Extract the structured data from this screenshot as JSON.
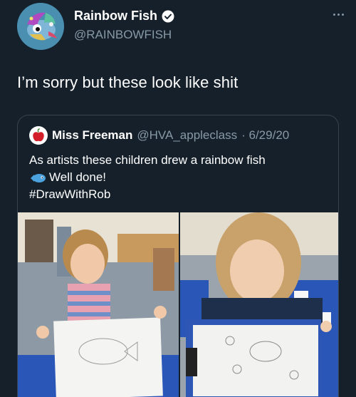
{
  "tweet": {
    "author": {
      "display_name": "Rainbow Fish",
      "handle": "@RAINBOWFISH",
      "verified_icon": "verified-badge-icon"
    },
    "text": "I’m sorry but these look like shit",
    "more_icon": "more-options-icon"
  },
  "quote": {
    "display_name": "Miss Freeman",
    "handle": "@HVA_appleclass",
    "date": "· 6/29/20",
    "line1": "As artists these children drew a rainbow fish",
    "line2": "Well done!",
    "line3": "#DrawWithRob",
    "avatar_icon": "apple-icon",
    "emoji_icon": "fish-emoji-icon"
  },
  "photos": {
    "left": {
      "description_icon": "photo-girl-with-drawing"
    },
    "right": {
      "description_icon": "photo-girl-with-clipboard"
    }
  },
  "colors": {
    "background": "#15202b",
    "secondary_text": "#8899a6",
    "border": "#38444d"
  }
}
